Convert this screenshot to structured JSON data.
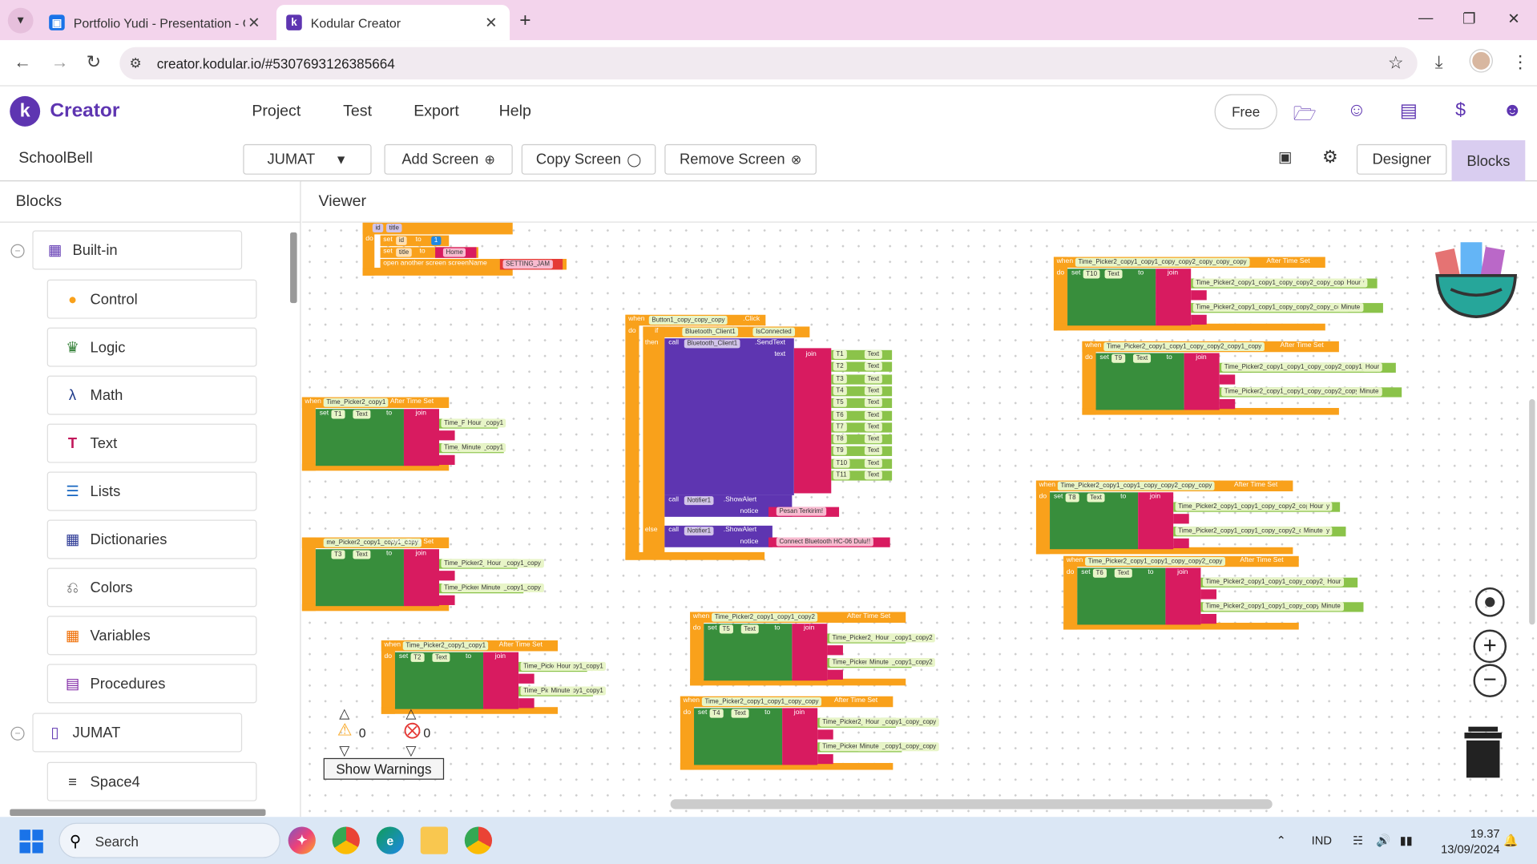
{
  "browser": {
    "tabs": [
      {
        "title": "Portfolio Yudi - Presentation - G",
        "active": false
      },
      {
        "title": "Kodular Creator",
        "active": true
      }
    ],
    "url": "creator.kodular.io/#5307693126385664"
  },
  "app": {
    "brand": "Creator",
    "menu": [
      "Project",
      "Test",
      "Export",
      "Help"
    ],
    "free_label": "Free"
  },
  "project": {
    "name": "SchoolBell",
    "screen_select": "JUMAT",
    "add_screen": "Add Screen",
    "copy_screen": "Copy Screen",
    "remove_screen": "Remove Screen",
    "designer": "Designer",
    "blocks": "Blocks"
  },
  "blocks_panel": {
    "title": "Blocks",
    "builtin": "Built-in",
    "items": [
      "Control",
      "Logic",
      "Math",
      "Text",
      "Lists",
      "Dictionaries",
      "Colors",
      "Variables",
      "Procedures"
    ],
    "screen": "JUMAT",
    "component": "Space4"
  },
  "viewer": {
    "title": "Viewer",
    "warnings_count": "0",
    "errors_count": "0",
    "show_warnings": "Show Warnings"
  },
  "blocks_text": {
    "b1": {
      "id": "id",
      "title": "title",
      "do": "do",
      "set1": "set",
      "id2": "id",
      "to": "to",
      "num": "1",
      "set2": "set",
      "title2": "title",
      "to2": "to",
      "home": "Home",
      "open": "open another screen  screenName",
      "setting": "SETTING_JAM"
    },
    "button_click": {
      "when": "when",
      "comp": "Button1_copy_copy_copy",
      "event": ".Click",
      "do": "do",
      "if": "if",
      "bt": "Bluetooth_Client1",
      "isconn": "IsConnected",
      "then": "then",
      "call": "call",
      "bt2": "Bluetooth_Client1",
      "send": ".SendText",
      "text": "text",
      "join": "join",
      "items": [
        "T1",
        "T2",
        "T3",
        "T4",
        "T5",
        "T6",
        "T7",
        "T8",
        "T9",
        "T10",
        "T11"
      ],
      "textprop": "Text",
      "notifier": "Notifier1",
      "showalert": ".ShowAlert",
      "notice": "notice",
      "msg1": "Pesan Terkirim!",
      "else": "else",
      "msg2": "Connect Bluetooth HC-06 Dulu!!"
    },
    "tp_a": {
      "when": "when",
      "comp": "Time_Picker2_copy1",
      "event": "After Time Set",
      "set": "set",
      "target": "T1",
      "text": "Text",
      "to": "to",
      "join": "join",
      "q": ":",
      "hour": "Hour",
      "minute": "Minute",
      "p1": "Time_Picker2_copy1",
      "p2": "Time_Picker2_copy1"
    },
    "tp_b": {
      "comp": "me_Picker2_copy1_copy1_copy",
      "event": "After Time Set",
      "target": "T3",
      "text": "Text",
      "to": "to",
      "join": "join",
      "p1": "Time_Picker2_copy1_copy1_copy",
      "p2": "Time_Picker2_copy1_copy1_copy",
      "hour": "Hour",
      "minute": "Minute"
    },
    "tp_c": {
      "when": "when",
      "comp": "Time_Picker2_copy1_copy1",
      "event": "After Time Set",
      "do": "do",
      "set": "set",
      "target": "T2",
      "text": "Text",
      "to": "to",
      "join": "join",
      "p1": "Time_Picker2_copy1_copy1",
      "p2": "Time_Picker2_copy1_copy1",
      "hour": "Hour",
      "minute": "Minute"
    },
    "tp_d": {
      "when": "when",
      "comp": "Time_Picker2_copy1_copy1_copy2",
      "event": "After Time Set",
      "do": "do",
      "set": "set",
      "target": "T5",
      "text": "Text",
      "to": "to",
      "join": "join",
      "p1": "Time_Picker2_copy1_copy1_copy2",
      "p2": "Time_Picker2_copy1_copy1_copy2",
      "hour": "Hour",
      "minute": "Minute"
    },
    "tp_e": {
      "when": "when",
      "comp": "Time_Picker2_copy1_copy1_copy_copy",
      "event": "After Time Set",
      "do": "do",
      "set": "set",
      "target": "T4",
      "text": "Text",
      "to": "to",
      "join": "join",
      "p1": "Time_Picker2_copy1_copy1_copy_copy",
      "p2": "Time_Picker2_copy1_copy1_copy_copy",
      "hour": "Hour",
      "minute": "Minute"
    },
    "tp_f": {
      "when": "when",
      "comp": "Time_Picker2_copy1_copy1_copy_copy2_copy_copy_copy",
      "event": "After Time Set",
      "do": "do",
      "set": "set",
      "target": "T10",
      "text": "Text",
      "to": "to",
      "join": "join",
      "p1": "Time_Picker2_copy1_copy1_copy_copy2_copy_copy_copy",
      "p2": "Time_Picker2_copy1_copy1_copy_copy2_copy_copy",
      "hour": "Hour",
      "minute": "Minute"
    },
    "tp_g": {
      "when": "when",
      "comp": "Time_Picker2_copy1_copy1_copy_copy2_copy1_copy",
      "event": "After Time Set",
      "do": "do",
      "set": "set",
      "target": "T9",
      "text": "Text",
      "to": "to",
      "join": "join",
      "p1": "Time_Picker2_copy1_copy1_copy_copy2_copy1_copy",
      "p2": "Time_Picker2_copy1_copy1_copy_copy2_copy1_copy",
      "hour": "Hour",
      "minute": "Minute"
    },
    "tp_h": {
      "when": "when",
      "comp": "Time_Picker2_copy1_copy1_copy_copy2_copy_copy",
      "event": "After Time Set",
      "do": "do",
      "set": "set",
      "target": "T8",
      "text": "Text",
      "to": "to",
      "join": "join",
      "p1": "Time_Picker2_copy1_copy1_copy_copy2_copy_copy",
      "p2": "Time_Picker2_copy1_copy1_copy_copy2_copy_copy",
      "hour": "Hour",
      "minute": "Minute"
    },
    "tp_i": {
      "when": "when",
      "comp": "Time_Picker2_copy1_copy1_copy_copy2_copy",
      "event": "After Time Set",
      "do": "do",
      "set": "set",
      "target": "T6",
      "text": "Text",
      "to": "to",
      "join": "join",
      "p1": "Time_Picker2_copy1_copy1_copy_copy2_copy",
      "p2": "Time_Picker2_copy1_copy1_copy_copy2_copy",
      "hour": "Hour",
      "minute": "Minute"
    }
  },
  "taskbar": {
    "search": "Search",
    "lang": "IND",
    "time": "19.37",
    "date": "13/09/2024"
  },
  "colors": {
    "accent": "#5e35b1",
    "event_orange": "#f9a11b",
    "text_pink": "#d81b60",
    "component_green": "#8bc34a"
  }
}
